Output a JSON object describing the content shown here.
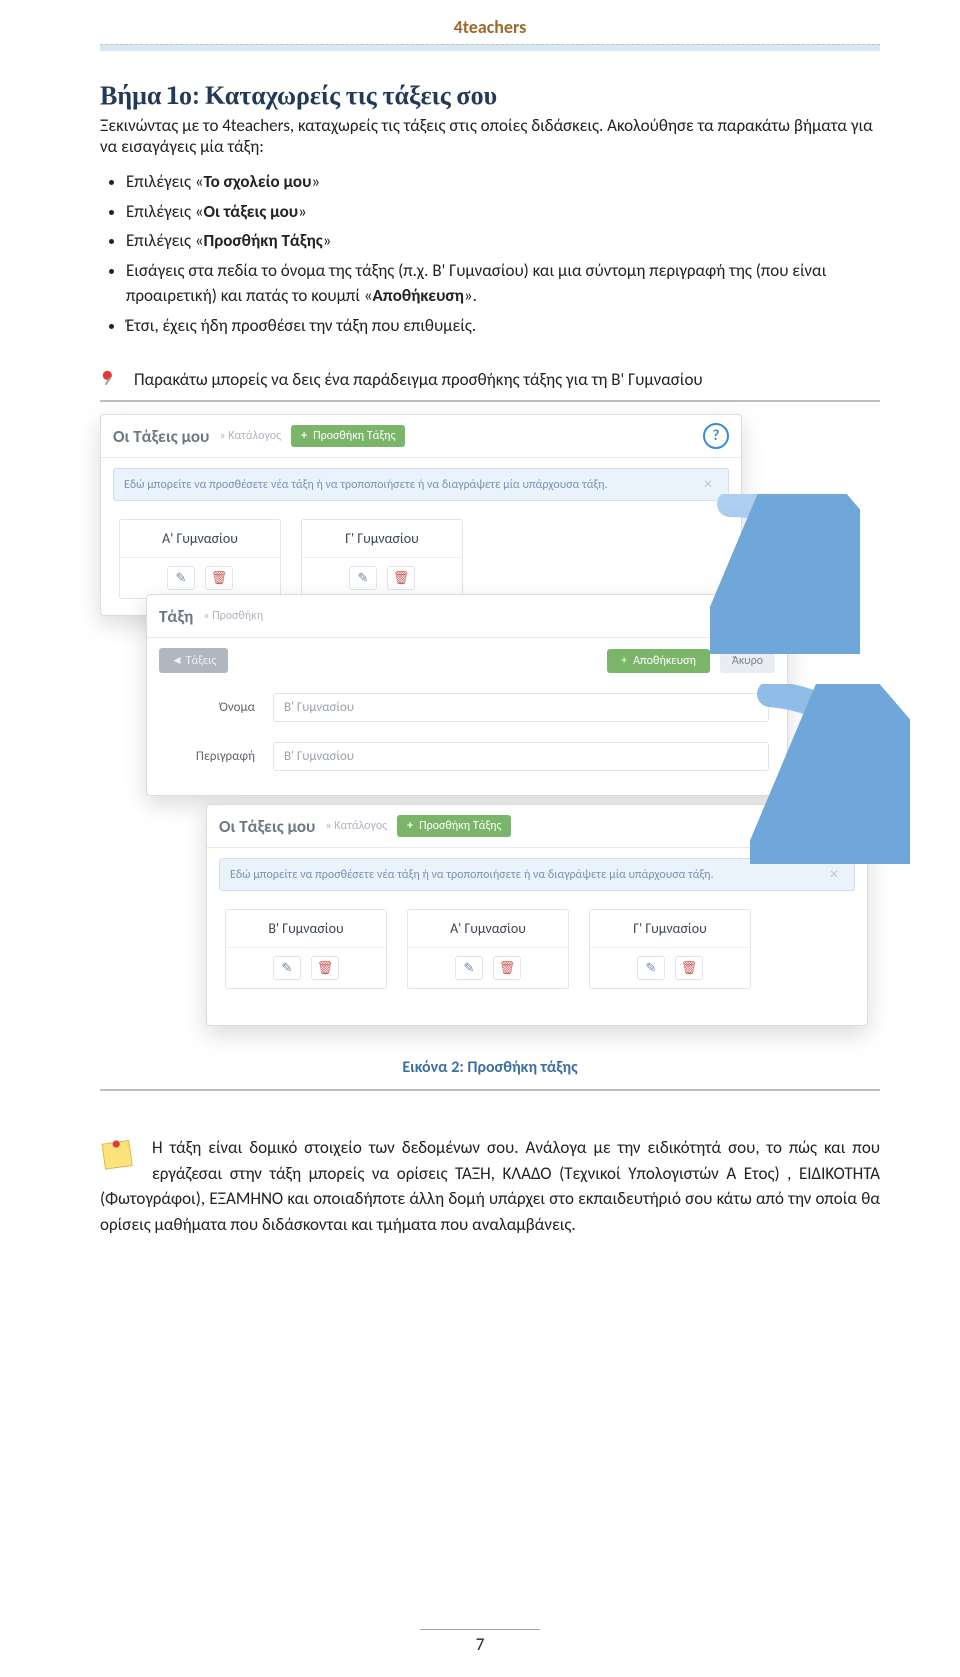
{
  "header": {
    "title": "4teachers"
  },
  "step": {
    "heading": "Βήμα 1ο: Καταχωρείς τις τάξεις σου",
    "intro": "Ξεκινώντας με το 4teachers, καταχωρείς τις τάξεις στις οποίες διδάσκεις. Ακολούθησε τα παρακάτω βήματα για να εισαγάγεις μία τάξη:",
    "bullets": [
      {
        "pre": "Επιλέγεις «",
        "bold": "Το σχολείο μου",
        "post": "»"
      },
      {
        "pre": "Επιλέγεις «",
        "bold": "Οι τάξεις μου",
        "post": "»"
      },
      {
        "pre": "Επιλέγεις «",
        "bold": "Προσθήκη Τάξης",
        "post": "»"
      },
      {
        "pre": "Εισάγεις στα πεδία το όνομα της τάξης (π.χ. Β' Γυμνασίου) και μια σύντομη περιγραφή της (που είναι προαιρετική) και πατάς το κουμπί «",
        "bold": "Αποθήκευση",
        "post": "»."
      },
      {
        "pre": "Έτσι, έχεις ήδη προσθέσει την τάξη που επιθυμείς.",
        "bold": "",
        "post": ""
      }
    ]
  },
  "note": {
    "text": "Παρακάτω μπορείς να δεις ένα παράδειγμα προσθήκης τάξης για τη Β' Γυμνασίου"
  },
  "figure": {
    "panel1": {
      "title": "Οι Τάξεις μου",
      "crumb": "» Κατάλογος",
      "add_label": "Προσθήκη Τάξης",
      "info": "Εδώ μπορείτε να προσθέσετε νέα τάξη ή να τροποποιήσετε ή να διαγράψετε μία υπάρχουσα τάξη.",
      "cards": [
        "Α' Γυμνασίου",
        "Γ' Γυμνασίου"
      ]
    },
    "panel2": {
      "title": "Τάξη",
      "crumb": "» Προσθήκη",
      "back_label": "Τάξεις",
      "save_label": "Αποθήκευση",
      "cancel_label": "Άκυρο",
      "name_label": "Όνομα",
      "name_value": "Β' Γυμνασίου",
      "desc_label": "Περιγραφή",
      "desc_value": "Β' Γυμνασίου"
    },
    "panel3": {
      "title": "Οι Τάξεις μου",
      "crumb": "» Κατάλογος",
      "add_label": "Προσθήκη Τάξης",
      "info": "Εδώ μπορείτε να προσθέσετε νέα τάξη ή να τροποποιήσετε ή να διαγράψετε μία υπάρχουσα τάξη.",
      "cards": [
        "Β' Γυμνασίου",
        "Α' Γυμνασίου",
        "Γ' Γυμνασίου"
      ]
    },
    "caption": "Εικόνα 2: Προσθήκη τάξης"
  },
  "sticky": {
    "text": "Η τάξη είναι δομικό στοιχείο των δεδομένων σου. Ανάλογα με την ειδικότητά σου, το πώς και που εργάζεσαι στην τάξη μπορείς να ορίσεις ΤΑΞΗ, ΚΛΑΔΟ (Τεχνικοί Υπολογιστών Α Έτος) , ΕΙΔΙΚΟΤΗΤΑ (Φωτογράφοι), ΕΞΑΜΗΝΟ και οποιαδήποτε άλλη δομή υπάρχει στο εκπαιδευτήριό σου κάτω από την οποία θα ορίσεις μαθήματα που διδάσκονται και τμήματα που αναλαμβάνεις."
  },
  "page_number": "7"
}
